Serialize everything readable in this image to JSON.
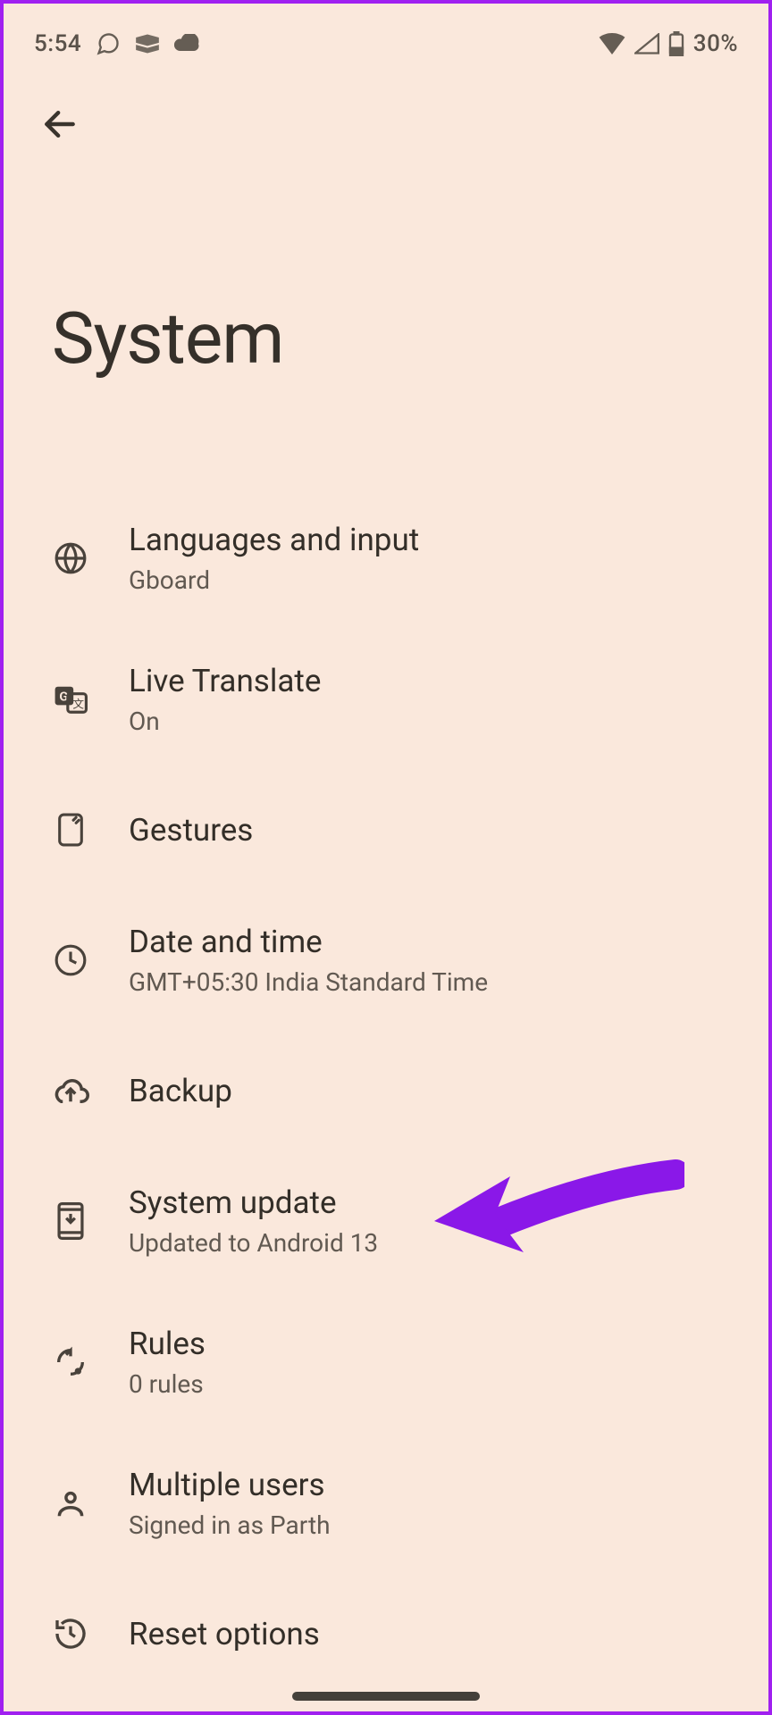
{
  "status": {
    "time": "5:54",
    "battery_pct": "30%"
  },
  "page": {
    "title": "System"
  },
  "items": [
    {
      "key": "languages",
      "title": "Languages and input",
      "subtitle": "Gboard"
    },
    {
      "key": "translate",
      "title": "Live Translate",
      "subtitle": "On"
    },
    {
      "key": "gestures",
      "title": "Gestures",
      "subtitle": ""
    },
    {
      "key": "datetime",
      "title": "Date and time",
      "subtitle": "GMT+05:30 India Standard Time"
    },
    {
      "key": "backup",
      "title": "Backup",
      "subtitle": ""
    },
    {
      "key": "update",
      "title": "System update",
      "subtitle": "Updated to Android 13"
    },
    {
      "key": "rules",
      "title": "Rules",
      "subtitle": "0 rules"
    },
    {
      "key": "users",
      "title": "Multiple users",
      "subtitle": "Signed in as Parth"
    },
    {
      "key": "reset",
      "title": "Reset options",
      "subtitle": ""
    }
  ]
}
